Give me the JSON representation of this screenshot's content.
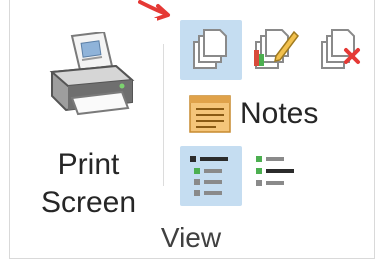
{
  "ribbon_group": {
    "label": "View",
    "print_screen": {
      "label_line1": "Print",
      "label_line2": "Screen"
    },
    "notes": {
      "label": "Notes"
    },
    "buttons": [
      {
        "icon": "pages-icon",
        "active": true
      },
      {
        "icon": "pages-edit-icon",
        "active": false
      },
      {
        "icon": "pages-delete-icon",
        "active": false
      },
      {
        "icon": "outline-list-icon",
        "active": true
      },
      {
        "icon": "outline-tree-icon",
        "active": false
      }
    ]
  },
  "colors": {
    "active_bg": "#c5ddf1",
    "arrow": "#e53935",
    "text": "#262626"
  }
}
